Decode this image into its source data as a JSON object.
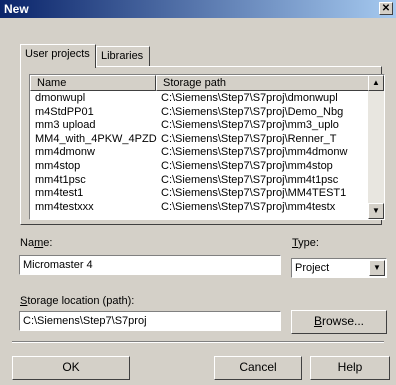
{
  "window": {
    "title": "New",
    "close_glyph": "✕"
  },
  "tabs": [
    {
      "label": "User projects",
      "active": true
    },
    {
      "label": "Libraries",
      "active": false
    }
  ],
  "list": {
    "columns": [
      "Name",
      "Storage path"
    ],
    "rows": [
      {
        "name": "dmonwupl",
        "path": "C:\\Siemens\\Step7\\S7proj\\dmonwupl"
      },
      {
        "name": "m4StdPP01",
        "path": "C:\\Siemens\\Step7\\S7proj\\Demo_Nbg"
      },
      {
        "name": "mm3 upload",
        "path": "C:\\Siemens\\Step7\\S7proj\\mm3_uplo"
      },
      {
        "name": "MM4_with_4PKW_4PZD",
        "path": "C:\\Siemens\\Step7\\S7proj\\Renner_T"
      },
      {
        "name": "mm4dmonw",
        "path": "C:\\Siemens\\Step7\\S7proj\\mm4dmonw"
      },
      {
        "name": "mm4stop",
        "path": "C:\\Siemens\\Step7\\S7proj\\mm4stop"
      },
      {
        "name": "mm4t1psc",
        "path": "C:\\Siemens\\Step7\\S7proj\\mm4t1psc"
      },
      {
        "name": "mm4test1",
        "path": "C:\\Siemens\\Step7\\S7proj\\MM4TEST1"
      },
      {
        "name": "mm4testxxx",
        "path": "C:\\Siemens\\Step7\\S7proj\\mm4testx"
      }
    ]
  },
  "form": {
    "name_label_pre": "Na",
    "name_label_key": "m",
    "name_label_post": "e:",
    "name_value": "Micromaster 4",
    "type_label_key": "T",
    "type_label_post": "ype:",
    "type_value": "Project",
    "storage_label_key": "S",
    "storage_label_post": "torage location (path):",
    "storage_value": "C:\\Siemens\\Step7\\S7proj",
    "browse_key": "B",
    "browse_post": "rowse..."
  },
  "buttons": {
    "ok": "OK",
    "cancel": "Cancel",
    "help": "Help"
  },
  "colors": {
    "title_start": "#0a246a",
    "title_end": "#a6caf0",
    "face": "#d4d0c8"
  }
}
